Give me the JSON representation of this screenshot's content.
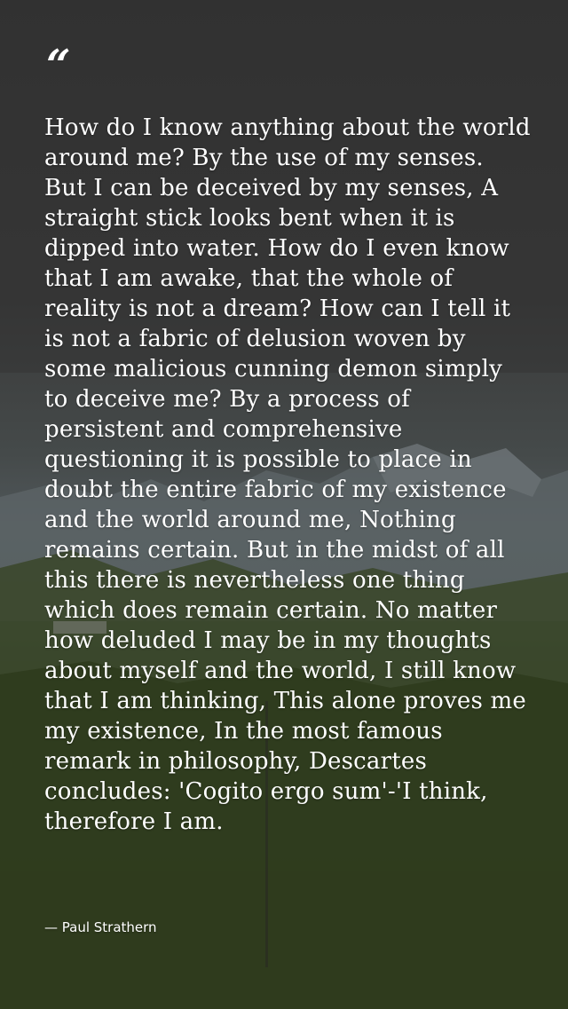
{
  "quote": {
    "mark": "“",
    "text": "How do I know anything about the world around me? By the use of my senses. But I can be deceived by my senses, A straight stick looks bent when it is dipped into water. How do I even know that I am awake, that the whole of reality is not a dream? How can I tell it is not a fabric of delusion woven by some malicious cunning demon simply to deceive me? By a process of persistent and comprehensive questioning it is possible to place in doubt the entire fabric of my existence and the world around me, Nothing remains certain. But in the midst of all this there is nevertheless one thing which does remain certain. No matter how deluded I may be in my thoughts about myself and the world, I still know that I am thinking, This alone proves me my existence, In the most famous remark in philosophy, Descartes concludes: 'Cogito ergo sum'-'I think, therefore I am.",
    "author": "— Paul Strathern"
  },
  "colors": {
    "text": "#ffffff",
    "sky": "#3a3a3a",
    "mountains": "#5a6266",
    "forest": "#2f3b20"
  }
}
